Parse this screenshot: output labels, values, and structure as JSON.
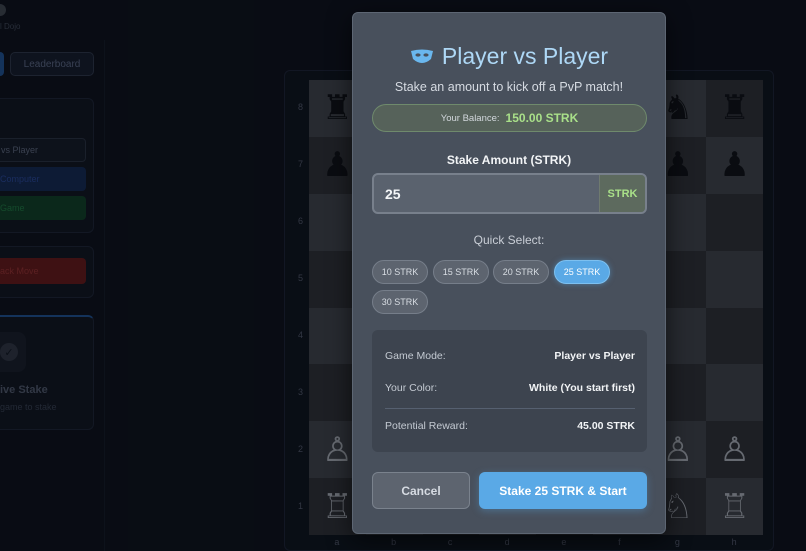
{
  "background": {
    "top_text": "l Dojo",
    "nav": {
      "leaderboard_label": "Leaderboard"
    },
    "modes": {
      "pvp_label": "vs Player",
      "computer_label": "Computer",
      "new_game_label": "Game",
      "undo_label": "ack Move"
    },
    "stake_panel": {
      "title": "ive Stake",
      "subtitle": "game to stake"
    },
    "board": {
      "ranks": [
        "8",
        "7",
        "6",
        "5",
        "4",
        "3",
        "2",
        "1"
      ],
      "files": [
        "a",
        "b",
        "c",
        "d",
        "e",
        "f",
        "g",
        "h"
      ]
    }
  },
  "modal": {
    "title": "Player vs Player",
    "title_icon": "mask-icon",
    "subtitle": "Stake an amount to kick off a PvP match!",
    "balance": {
      "label": "Your Balance:",
      "value": "150.00 STRK"
    },
    "stake": {
      "label": "Stake Amount (STRK)",
      "value": "25",
      "unit": "STRK"
    },
    "quick_select": {
      "label": "Quick Select:",
      "options": [
        "10 STRK",
        "15 STRK",
        "20 STRK",
        "25 STRK",
        "30 STRK"
      ],
      "selected": "25 STRK"
    },
    "info": {
      "mode_label": "Game Mode:",
      "mode_value": "Player vs Player",
      "color_label": "Your Color:",
      "color_value": "White (You start first)",
      "reward_label": "Potential Reward:",
      "reward_value": "45.00 STRK"
    },
    "buttons": {
      "cancel": "Cancel",
      "start": "Stake 25 STRK & Start"
    }
  },
  "colors": {
    "accent": "#5aa9e6",
    "balance_green": "#a9e089",
    "title_blue": "#aed8f6"
  }
}
